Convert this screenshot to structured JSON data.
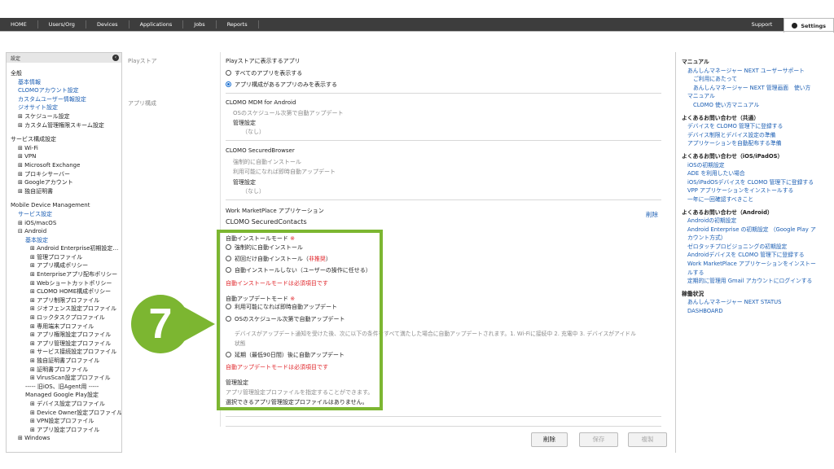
{
  "topnav": {
    "items": [
      "HOME",
      "Users/Org",
      "Devices",
      "Applications",
      "Jobs",
      "Reports"
    ],
    "support": "Support",
    "settings": "Settings"
  },
  "sidebar": {
    "header": "設定",
    "lines": [
      {
        "text": "全般",
        "kind": "section"
      },
      {
        "text": "基本情報",
        "kind": "link"
      },
      {
        "text": "CLOMOアカウント設定",
        "kind": "link"
      },
      {
        "text": "カスタムユーザー情報設定",
        "kind": "link"
      },
      {
        "text": "ジオサイト設定",
        "kind": "link"
      },
      {
        "text": "⊞ スケジュール設定",
        "kind": "tree"
      },
      {
        "text": "⊞ カスタム管理権限スキーム設定",
        "kind": "tree"
      },
      {
        "text": "",
        "kind": "gap"
      },
      {
        "text": "サービス構成設定",
        "kind": "section"
      },
      {
        "text": "⊞ Wi-Fi",
        "kind": "tree"
      },
      {
        "text": "⊞ VPN",
        "kind": "tree"
      },
      {
        "text": "⊞ Microsoft Exchange",
        "kind": "tree"
      },
      {
        "text": "⊞ プロキシサーバー",
        "kind": "tree"
      },
      {
        "text": "⊞ Googleアカウント",
        "kind": "tree"
      },
      {
        "text": "⊞ 独自証明書",
        "kind": "tree"
      },
      {
        "text": "",
        "kind": "gap"
      },
      {
        "text": "Mobile Device Management",
        "kind": "section"
      },
      {
        "text": "サービス設定",
        "kind": "link"
      },
      {
        "text": "⊞ iOS/macOS",
        "kind": "tree"
      },
      {
        "text": "⊟ Android",
        "kind": "tree"
      },
      {
        "text": "基本設定",
        "kind": "link2"
      },
      {
        "text": "⊞ Android Enterprise初期設定…",
        "kind": "tree3"
      },
      {
        "text": "⊞ 管理プロファイル",
        "kind": "tree3"
      },
      {
        "text": "⊞ アプリ構成ポリシー",
        "kind": "tree3"
      },
      {
        "text": "⊞ Enterpriseアプリ配布ポリシー",
        "kind": "tree3"
      },
      {
        "text": "⊞ Webショートカットポリシー",
        "kind": "tree3"
      },
      {
        "text": "⊞ CLOMO HOME構成ポリシー",
        "kind": "tree3"
      },
      {
        "text": "⊞ アプリ制限プロファイル",
        "kind": "tree3"
      },
      {
        "text": "⊞ ジオフェンス設定プロファイル",
        "kind": "tree3"
      },
      {
        "text": "⊞ ロックタスクプロファイル",
        "kind": "tree3"
      },
      {
        "text": "⊞ 専用端末プロファイル",
        "kind": "tree3"
      },
      {
        "text": "⊞ アプリ権限設定プロファイル",
        "kind": "tree3"
      },
      {
        "text": "⊞ アプリ管理設定プロファイル",
        "kind": "tree3"
      },
      {
        "text": "⊞ サービス接続設定プロファイル",
        "kind": "tree3"
      },
      {
        "text": "⊞ 独自証明書プロファイル",
        "kind": "tree3"
      },
      {
        "text": "⊞ 証明書プロファイル",
        "kind": "tree3"
      },
      {
        "text": "⊞ VirusScan設定プロファイル",
        "kind": "tree3"
      },
      {
        "text": "----- 旧iOS、旧Agent用 -----",
        "kind": "tree2"
      },
      {
        "text": "Managed Google Play設定",
        "kind": "tree2"
      },
      {
        "text": "⊞ デバイス設定プロファイル",
        "kind": "tree3"
      },
      {
        "text": "⊞ Device Owner設定プロファイル",
        "kind": "tree3"
      },
      {
        "text": "⊞ VPN設定プロファイル",
        "kind": "tree3"
      },
      {
        "text": "⊞ アプリ設定プロファイル",
        "kind": "tree3"
      },
      {
        "text": "⊞ Windows",
        "kind": "tree"
      }
    ]
  },
  "main": {
    "playstore_label": "Playストア",
    "playstore_heading": "Playストアに表示するアプリ",
    "playstore_opt_all": "すべてのアプリを表示する",
    "playstore_opt_configured": "アプリ構成があるアプリのみを表示する",
    "apps_label": "アプリ構成",
    "mdm_title": "CLOMO MDM for Android",
    "mdm_line1": "OSのスケジュール次第で自動アップデート",
    "mdm_mgmt": "管理設定",
    "mdm_none": "（なし）",
    "browser_title": "CLOMO SecuredBrowser",
    "browser_line1": "強制的に自動インストール",
    "browser_line2": "利用可能になれば即時自動アップデート",
    "browser_mgmt": "管理設定",
    "browser_none": "（なし）",
    "wm_heading": "Work MarketPlace アプリケーション",
    "wm_delete": "削除",
    "contacts_title": "CLOMO SecuredContacts",
    "install_mode_label": "自動インストールモード",
    "required_mark": "※",
    "install_opt1": "強制的に自動インストール",
    "install_opt2": "初回だけ自動インストール（",
    "install_opt2_note": "非推奨",
    "install_opt2_end": "）",
    "install_opt3": "自動インストールしない（ユーザーの操作に任せる）",
    "install_error": "自動インストールモードは必須項目です",
    "update_mode_label": "自動アップデートモード",
    "update_opt1": "利用可能になれば即時自動アップデート",
    "update_opt2": "OSのスケジュール次第で自動アップデート",
    "update_opt2_desc1": "デバイスがアップデート通知を受けた後、次に以下の条件をすべて満たした場合に自動アップデートされます。1. Wi-Fiに接続中 2. 充電中 3. デバイスがアイドル",
    "update_opt2_desc2": "状態",
    "update_opt3": "延期（最低90日間）後に自動アップデート",
    "update_error": "自動アップデートモードは必須項目です",
    "mgmt_heading": "管理設定",
    "mgmt_desc": "アプリ管理設定プロファイルを指定することができます。",
    "mgmt_none": "選択できるアプリ管理設定プロファイルはありません。",
    "step_number": "7",
    "buttons": {
      "delete": "削除",
      "save": "保存",
      "copy": "複製"
    }
  },
  "rightpanel": {
    "lines": [
      {
        "text": "マニュアル",
        "kind": "head"
      },
      {
        "text": "あんしんマネージャー NEXT ユーザーサポート",
        "kind": "link"
      },
      {
        "text": "ご利用にあたって",
        "kind": "link2"
      },
      {
        "text": "あんしんマネージャー NEXT 管理画面　使い方",
        "kind": "link2"
      },
      {
        "text": "マニュアル",
        "kind": "link"
      },
      {
        "text": "CLOMO 使い方マニュアル",
        "kind": "link2"
      },
      {
        "text": "",
        "kind": "gap"
      },
      {
        "text": "よくあるお問い合わせ（共通）",
        "kind": "head"
      },
      {
        "text": "デバイスを CLOMO 管理下に登録する",
        "kind": "link"
      },
      {
        "text": "デバイス制限とデバイス設定の準備",
        "kind": "link"
      },
      {
        "text": "アプリケーションを自動配布する準備",
        "kind": "link"
      },
      {
        "text": "",
        "kind": "gap"
      },
      {
        "text": "よくあるお問い合わせ（iOS/iPadOS）",
        "kind": "head"
      },
      {
        "text": "iOSの初期設定",
        "kind": "link"
      },
      {
        "text": "ADE を利用したい場合",
        "kind": "link"
      },
      {
        "text": "iOS/iPadOSデバイスを CLOMO 管理下に登録する",
        "kind": "link"
      },
      {
        "text": "VPP アプリケーションをインストールする",
        "kind": "link"
      },
      {
        "text": "一年に一回確認すべきこと",
        "kind": "link"
      },
      {
        "text": "",
        "kind": "gap"
      },
      {
        "text": "よくあるお問い合わせ（Android）",
        "kind": "head"
      },
      {
        "text": "Androidの初期設定",
        "kind": "link"
      },
      {
        "text": "Android Enterprise の初期設定 （Google Play ア",
        "kind": "link"
      },
      {
        "text": "カウント方式）",
        "kind": "link"
      },
      {
        "text": "ゼロタッチプロビジョニングの初期設定",
        "kind": "link"
      },
      {
        "text": "Androidデバイスを CLOMO 管理下に登録する",
        "kind": "link"
      },
      {
        "text": "Work MarketPlace アプリケーションをインストー",
        "kind": "link"
      },
      {
        "text": "ルする",
        "kind": "link"
      },
      {
        "text": "定期的に管理用 Gmail アカウントにログインする",
        "kind": "link"
      },
      {
        "text": "",
        "kind": "gap"
      },
      {
        "text": "稼働状況",
        "kind": "head"
      },
      {
        "text": "あんしんマネージャー NEXT STATUS",
        "kind": "link"
      },
      {
        "text": "DASHBOARD",
        "kind": "link"
      }
    ]
  }
}
